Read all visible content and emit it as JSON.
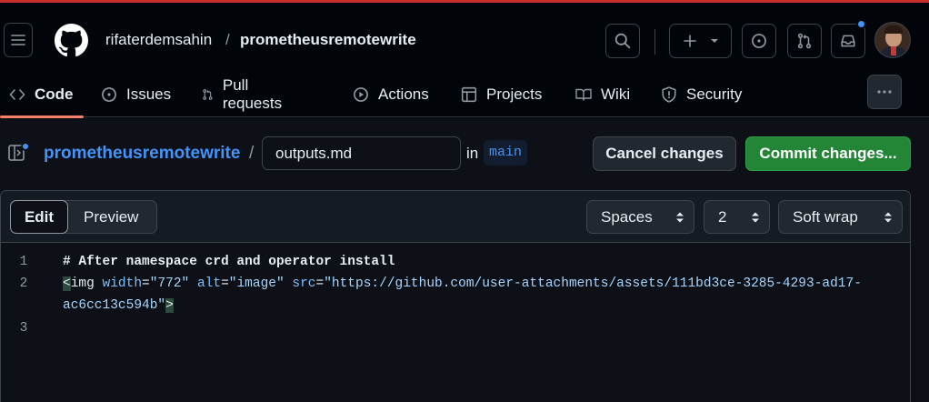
{
  "header": {
    "owner": "rifaterdemsahin",
    "separator": "/",
    "repo": "prometheusremotewrite",
    "icons": [
      "menu-icon",
      "github-logo-icon",
      "search-icon",
      "plus-icon",
      "chevron-down-icon",
      "issue-opened-icon",
      "git-pull-request-icon",
      "inbox-icon",
      "avatar"
    ],
    "notification_dot_color": "#4493f8"
  },
  "tabs": [
    {
      "label": "Code",
      "icon": "code-icon",
      "active": true
    },
    {
      "label": "Issues",
      "icon": "issue-opened-icon"
    },
    {
      "label": "Pull requests",
      "icon": "git-pull-request-icon"
    },
    {
      "label": "Actions",
      "icon": "play-icon"
    },
    {
      "label": "Projects",
      "icon": "table-icon"
    },
    {
      "label": "Wiki",
      "icon": "book-icon"
    },
    {
      "label": "Security",
      "icon": "shield-icon"
    }
  ],
  "editor_header": {
    "repo_link": "prometheusremotewrite",
    "separator": "/",
    "filename": "outputs.md",
    "in_label": "in",
    "branch": "main",
    "cancel_label": "Cancel changes",
    "commit_label": "Commit changes..."
  },
  "toolbar": {
    "edit_label": "Edit",
    "preview_label": "Preview",
    "indent_mode": "Spaces",
    "indent_size": "2",
    "wrap_mode": "Soft wrap"
  },
  "code": {
    "line_numbers": [
      "1",
      "2",
      "",
      "3"
    ],
    "line1": "# After namespace crd and operator install",
    "line2": {
      "tag_open": "<",
      "tag_name": "img",
      "attr1": "width",
      "eq1": "=",
      "val1": "\"772\"",
      "attr2": "alt",
      "eq2": "=",
      "val2": "\"image\"",
      "attr3": "src",
      "eq3": "=",
      "val3a": "\"https://github.com/user-attachments/assets/111bd3ce-3285-4293-ad17-",
      "val3b": "ac6cc13c594b\"",
      "tag_close": ">"
    }
  },
  "colors": {
    "accent": "#4493f8",
    "commit": "#238636",
    "tab_underline": "#f78166",
    "top_stripe": "#c9302c"
  }
}
